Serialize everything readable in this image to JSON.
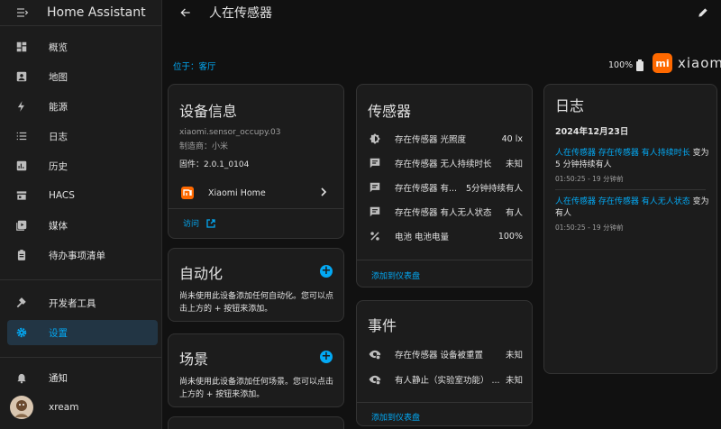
{
  "app": {
    "title": "Home Assistant"
  },
  "sidebar": {
    "items": [
      {
        "label": "概览"
      },
      {
        "label": "地图"
      },
      {
        "label": "能源"
      },
      {
        "label": "日志"
      },
      {
        "label": "历史"
      },
      {
        "label": "HACS"
      },
      {
        "label": "媒体"
      },
      {
        "label": "待办事项清单"
      },
      {
        "label": "开发者工具"
      },
      {
        "label": "设置"
      },
      {
        "label": "通知"
      },
      {
        "label": "xream"
      }
    ],
    "accent": "#03a9f4"
  },
  "page": {
    "title": "人在传感器"
  },
  "info": {
    "location": "位于：客厅",
    "battery": "100%",
    "brand": "xiaomi",
    "brand_logo": "mi"
  },
  "device": {
    "title": "设备信息",
    "model": "xiaomi.sensor_occupy.03",
    "manufacturer": "制造商：小米",
    "firmware": "固件：2.0.1_0104",
    "integration": "Xiaomi Home",
    "visit": "访问"
  },
  "automation": {
    "title": "自动化",
    "text": "尚未使用此设备添加任何自动化。您可以点击上方的 + 按钮来添加。"
  },
  "scene": {
    "title": "场景",
    "text": "尚未使用此设备添加任何场景。您可以点击上方的 + 按钮来添加。"
  },
  "sensors": {
    "title": "传感器",
    "rows": [
      {
        "name": "存在传感器 光照度",
        "value": "40 lx",
        "icon": "brightness-icon"
      },
      {
        "name": "存在传感器 无人持续时长",
        "value": "未知",
        "icon": "message-icon"
      },
      {
        "name": "存在传感器 有...",
        "value": "5分钟持续有人",
        "icon": "message-icon"
      },
      {
        "name": "存在传感器 有人无人状态",
        "value": "有人",
        "icon": "message-icon"
      },
      {
        "name": "电池 电池电量",
        "value": "100%",
        "icon": "percent-icon"
      }
    ],
    "add": "添加到仪表盘"
  },
  "events": {
    "title": "事件",
    "rows": [
      {
        "name": "存在传感器 设备被重置",
        "value": "未知",
        "icon": "eye-icon"
      },
      {
        "name": "有人静止（实验室功能） ...",
        "value": "未知",
        "icon": "eye-icon"
      }
    ],
    "add": "添加到仪表盘"
  },
  "logbook": {
    "title": "日志",
    "date": "2024年12月23日",
    "entries": [
      {
        "link": "人在传感器 存在传感器 有人持续时长",
        "text": " 变为 5 分钟持续有人",
        "time": "01:50:25 - 19 分钟前"
      },
      {
        "link": "人在传感器 存在传感器 有人无人状态",
        "text": " 变为 有人",
        "time": "01:50:25 - 19 分钟前"
      }
    ]
  }
}
